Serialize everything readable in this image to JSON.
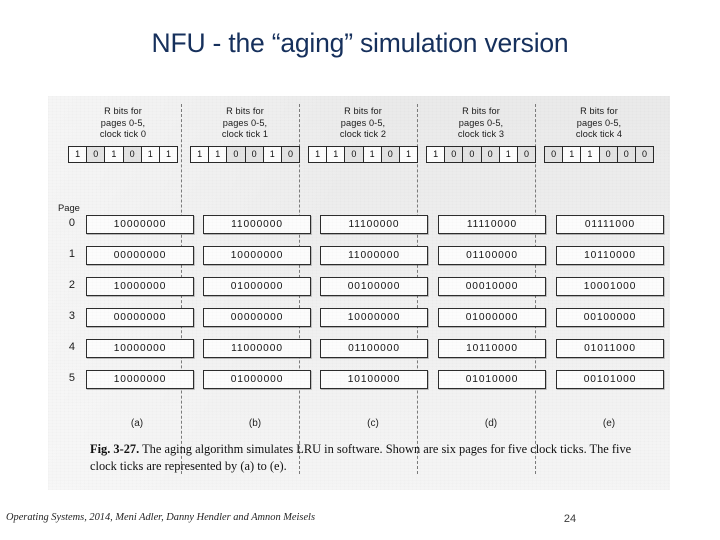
{
  "slide": {
    "title": "NFU - the “aging” simulation version",
    "number": "24",
    "footer": "Operating Systems, 2014, Meni Adler, Danny Hendler and Amnon Meisels",
    "title_color": "#16305c"
  },
  "figure": {
    "caption_label": "Fig. 3-27.",
    "caption_text": " The aging algorithm simulates LRU in software.  Shown are six pages for five clock ticks.  The five clock ticks are represented by (a) to (e).",
    "page_header": "Page",
    "page_numbers": [
      "0",
      "1",
      "2",
      "3",
      "4",
      "5"
    ],
    "sublabels": [
      "(a)",
      "(b)",
      "(c)",
      "(d)",
      "(e)"
    ],
    "columns": [
      {
        "head_line1": "R bits for",
        "head_line2": "pages 0-5,",
        "head_line3": "clock tick 0",
        "r_bits": [
          "1",
          "0",
          "1",
          "0",
          "1",
          "1"
        ],
        "counters": [
          "10000000",
          "00000000",
          "10000000",
          "00000000",
          "10000000",
          "10000000"
        ]
      },
      {
        "head_line1": "R bits for",
        "head_line2": "pages 0-5,",
        "head_line3": "clock tick 1",
        "r_bits": [
          "1",
          "1",
          "0",
          "0",
          "1",
          "0"
        ],
        "counters": [
          "11000000",
          "10000000",
          "01000000",
          "00000000",
          "11000000",
          "01000000"
        ]
      },
      {
        "head_line1": "R bits for",
        "head_line2": "pages 0-5,",
        "head_line3": "clock tick 2",
        "r_bits": [
          "1",
          "1",
          "0",
          "1",
          "0",
          "1"
        ],
        "counters": [
          "11100000",
          "11000000",
          "00100000",
          "10000000",
          "01100000",
          "10100000"
        ]
      },
      {
        "head_line1": "R bits for",
        "head_line2": "pages 0-5,",
        "head_line3": "clock tick 3",
        "r_bits": [
          "1",
          "0",
          "0",
          "0",
          "1",
          "0"
        ],
        "counters": [
          "11110000",
          "01100000",
          "00010000",
          "01000000",
          "10110000",
          "01010000"
        ]
      },
      {
        "head_line1": "R bits for",
        "head_line2": "pages 0-5,",
        "head_line3": "clock tick 4",
        "r_bits": [
          "0",
          "1",
          "1",
          "0",
          "0",
          "0"
        ],
        "counters": [
          "01111000",
          "10110000",
          "10001000",
          "00100000",
          "01011000",
          "00101000"
        ]
      }
    ]
  }
}
